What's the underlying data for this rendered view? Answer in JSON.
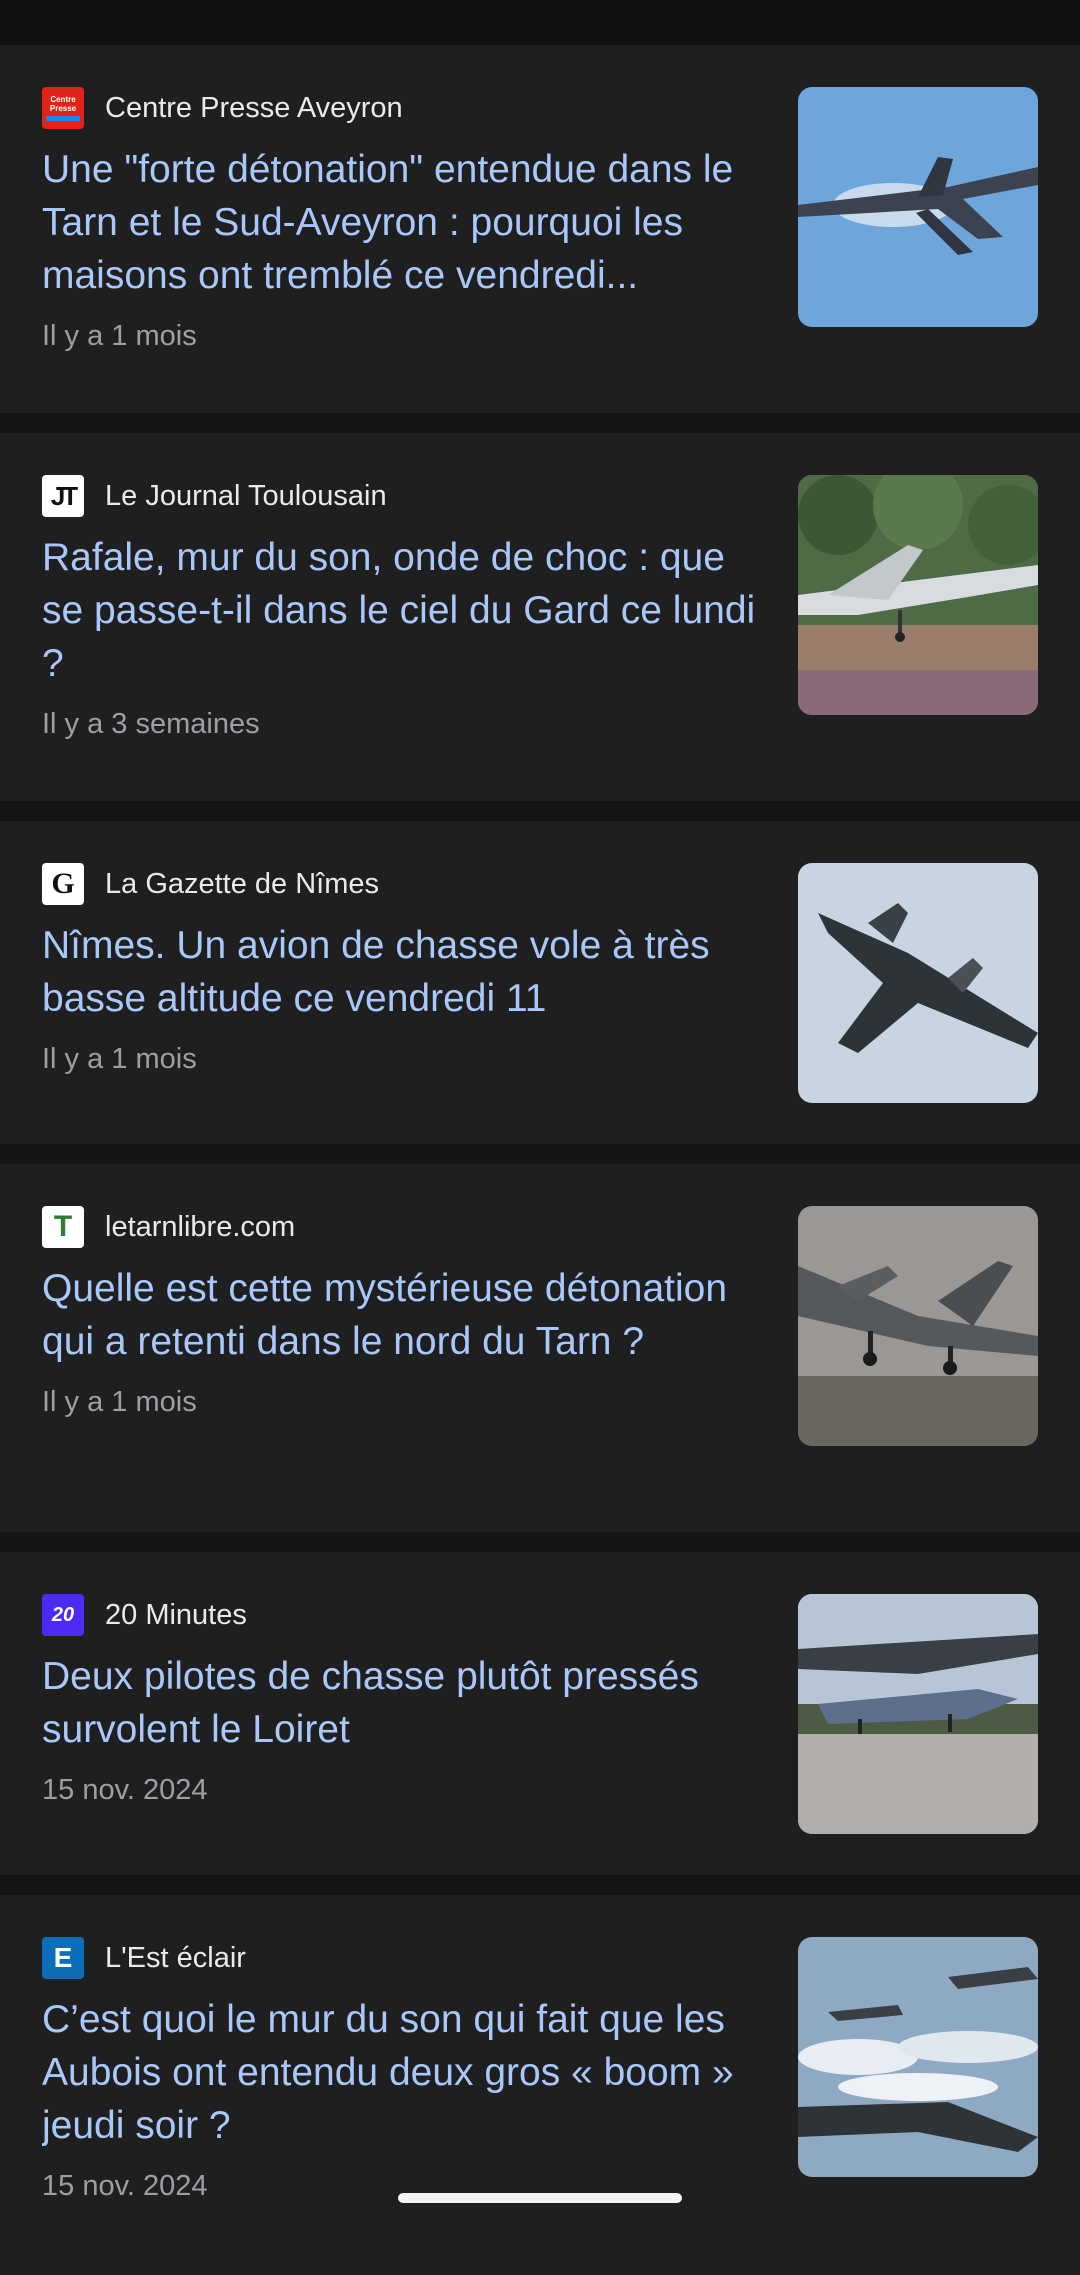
{
  "articles": [
    {
      "source": "Centre Presse Aveyron",
      "favicon": {
        "icon": "centre-presse-logo",
        "text": "Centre Presse",
        "bg": "#e2231a",
        "fg": "#ffffff"
      },
      "headline": "Une \"forte détonation\" entendue dans le Tarn et le Sud-Aveyron : pourquoi les maisons ont tremblé ce vendredi...",
      "time": "Il y a 1 mois",
      "thumbnail": "fighter-jet-blue-sky-image"
    },
    {
      "source": "Le Journal Toulousain",
      "favicon": {
        "icon": "journal-toulousain-logo",
        "text": "JT",
        "bg": "#ffffff",
        "fg": "#111111"
      },
      "headline": "Rafale, mur du son, onde de choc : que se passe-t-il dans le ciel du Gard ce lundi ?",
      "time": "Il y a 3 semaines",
      "thumbnail": "rafale-takeoff-forest-image"
    },
    {
      "source": "La Gazette de Nîmes",
      "favicon": {
        "icon": "gazette-nimes-logo",
        "text": "G",
        "bg": "#ffffff",
        "fg": "#111111"
      },
      "headline": "Nîmes. Un avion de chasse vole à très basse altitude ce vendredi 11",
      "time": "Il y a 1 mois",
      "thumbnail": "rafale-climbing-sky-image"
    },
    {
      "source": "letarnlibre.com",
      "favicon": {
        "icon": "letarnlibre-logo",
        "text": "T",
        "bg": "#ffffff",
        "fg": "#2e7d32"
      },
      "headline": "Quelle est cette mystérieuse détonation qui a retenti dans le nord du Tarn ?",
      "time": "Il y a 1 mois",
      "thumbnail": "rafale-landing-gear-image"
    },
    {
      "source": "20 Minutes",
      "favicon": {
        "icon": "20-minutes-logo",
        "text": "20",
        "bg": "#4a2cf5",
        "fg": "#ffffff"
      },
      "headline": "Deux pilotes de chasse plutôt pressés survolent le Loiret",
      "time": "15 nov. 2024",
      "thumbnail": "rafale-on-runway-image"
    },
    {
      "source": "L'Est éclair",
      "favicon": {
        "icon": "est-eclair-logo",
        "text": "E",
        "bg": "#0a6fb8",
        "fg": "#ffffff"
      },
      "headline": "C’est quoi le mur du son qui fait que les Aubois ont entendu deux gros « boom » jeudi soir ?",
      "time": "15 nov. 2024",
      "thumbnail": "rafale-formation-clouds-image"
    }
  ],
  "colors": {
    "background": "#141414",
    "card": "#1f1f1f",
    "headline": "#a8c7fa",
    "source": "#e8eaed",
    "time": "#9aa0a6"
  }
}
